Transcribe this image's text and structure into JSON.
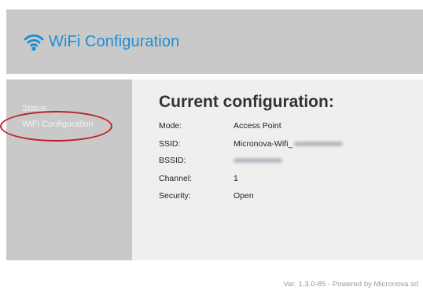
{
  "header": {
    "title": "WiFi Configuration",
    "icon": "wifi-icon",
    "accent_color": "#1a8fd6"
  },
  "sidebar": {
    "items": [
      {
        "label": "Status"
      },
      {
        "label": "WiFi Configuration",
        "highlighted": true
      }
    ]
  },
  "main": {
    "title": "Current configuration:",
    "rows": [
      {
        "label": "Mode:",
        "value": "Access Point"
      },
      {
        "label": "SSID:",
        "value": "Micronova-Wifi_",
        "redacted_suffix": true
      },
      {
        "label": "BSSID:",
        "value": "",
        "redacted": true
      },
      {
        "label": "Channel:",
        "value": "1"
      },
      {
        "label": "Security:",
        "value": "Open"
      }
    ]
  },
  "footer": {
    "text": "Ver. 1.3.0-85 - Powered by Micronova srl"
  },
  "colors": {
    "highlight": "#c0202a",
    "panel": "#c9c9c9",
    "content_bg": "#efefef"
  }
}
